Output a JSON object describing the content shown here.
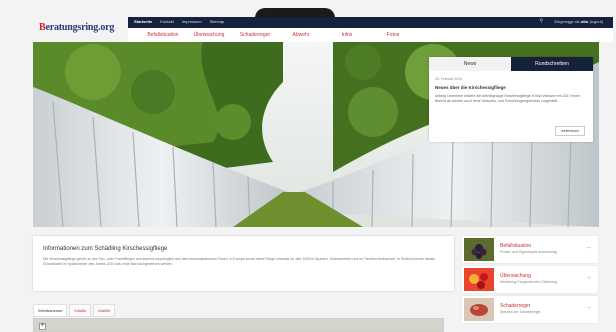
{
  "header": {
    "logo_prefix": "B",
    "logo_rest": "eratungsring.org",
    "topnav": [
      "Startseite",
      "Kontakt",
      "Impressum",
      "Sitemap"
    ],
    "login_prefix": "Eingeloggt als",
    "login_user": "otto",
    "login_suffix": "(logout)",
    "mainnav": [
      "Befallsituation",
      "Überwachung",
      "Schaderreger",
      "Abwehr",
      "Infos",
      "Fotos"
    ]
  },
  "news": {
    "tab_news": "News",
    "tab_rundschreiben": "Rundschreiben",
    "date": "26. Februar 2018",
    "headline": "Neues über die Kirschessigfliege",
    "text": "Anfang Dezember leistete die Arbeitsgruppe Kirschessigfliege in Bad Wiessee ein 2017 einen Bericht ab worden auch neue Versuchs- und Forschungsergebnisse vorgestellt.",
    "more": "weiterlesen"
  },
  "info": {
    "title": "Informationen zum Schädling Kirschessigfliege",
    "text": "Die Kirschessigfliege gehört zu den Tau- oder Fruchtfliegen und stammt ursprünglich aus dem südostasiatischen Raum. In Europa wurde diese Fliege erstmals im Jahr 2008 in Spanien, Südfrankreich und im Trentino beobachtet. In Südtirol konnte dieses Schadinsekt im Spätsommer des Jahres 2010 das erste Mal nachgewiesen werden."
  },
  "sidebar": {
    "items": [
      {
        "title": "Befallsituation",
        "sub": "Proben und Eigeninputs Auswertung",
        "icon": "grapes-thumbnail"
      },
      {
        "title": "Überwachung",
        "sub": "Monitoring Fangmethoden Tablerung",
        "icon": "berries-thumbnail"
      },
      {
        "title": "Schaderreger",
        "sub": "Spezies der Schaderreger",
        "icon": "fruit-thumbnail"
      }
    ]
  },
  "map": {
    "tabs": [
      "Weinbauzone",
      "Inhalte",
      "Marille"
    ],
    "zoom_in": "+"
  },
  "colors": {
    "navy": "#16213b",
    "accent_red": "#c8323a"
  }
}
